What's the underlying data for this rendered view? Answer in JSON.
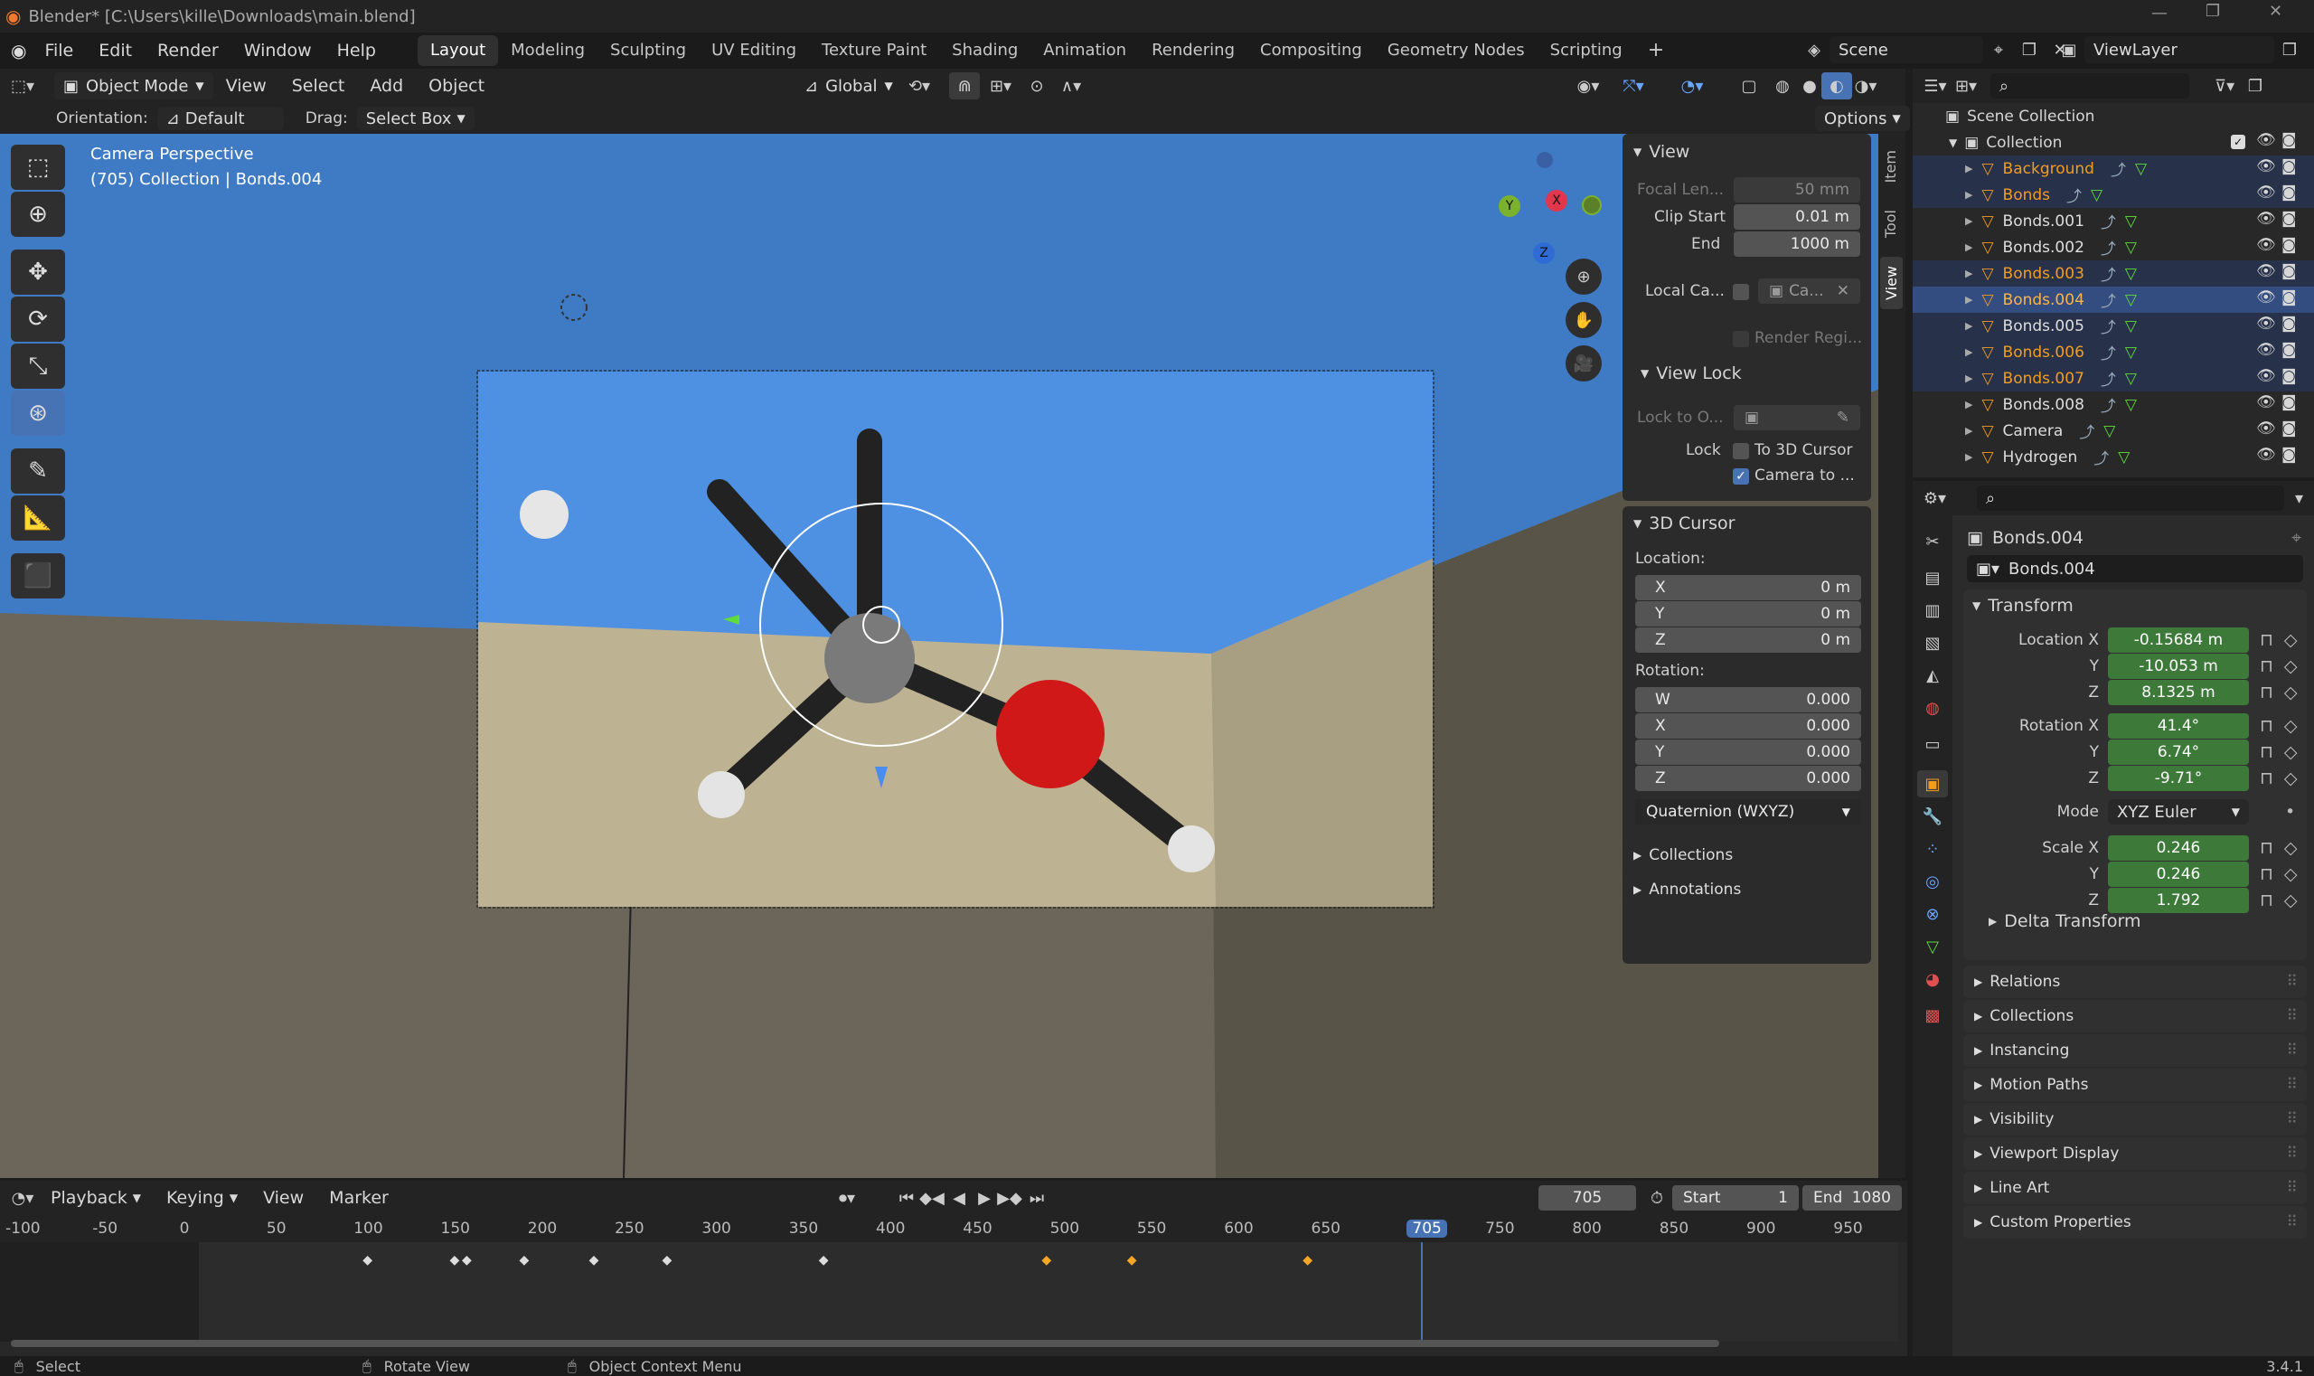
{
  "window": {
    "title": "Blender* [C:\\Users\\kille\\Downloads\\main.blend]"
  },
  "menu": [
    "File",
    "Edit",
    "Render",
    "Window",
    "Help"
  ],
  "workspaces": [
    "Layout",
    "Modeling",
    "Sculpting",
    "UV Editing",
    "Texture Paint",
    "Shading",
    "Animation",
    "Rendering",
    "Compositing",
    "Geometry Nodes",
    "Scripting"
  ],
  "scene": {
    "name": "Scene",
    "view_layer": "ViewLayer"
  },
  "viewport": {
    "mode": "Object Mode",
    "menus": [
      "View",
      "Select",
      "Add",
      "Object"
    ],
    "transform": "Global",
    "orientation_label": "Orientation:",
    "orientation": "Default",
    "drag_label": "Drag:",
    "drag": "Select Box",
    "options": "Options",
    "camera_label": "Camera Perspective",
    "info": "(705) Collection | Bonds.004"
  },
  "npanel": {
    "tabs": [
      "Item",
      "Tool",
      "View"
    ],
    "view_title": "View",
    "focal_label": "Focal Len...",
    "focal": "50 mm",
    "clip_start_label": "Clip Start",
    "clip_start": "0.01 m",
    "end_label": "End",
    "end": "1000 m",
    "local_cam_label": "Local Ca...",
    "local_cam": "Ca...",
    "render_region": "Render Regi...",
    "view_lock_title": "View Lock",
    "lock_to_label": "Lock to O...",
    "lock_label": "Lock",
    "to_3d_cursor": "To 3D Cursor",
    "camera_to": "Camera to ...",
    "cursor_title": "3D Cursor",
    "location_label": "Location:",
    "loc": [
      {
        "k": "X",
        "v": "0 m"
      },
      {
        "k": "Y",
        "v": "0 m"
      },
      {
        "k": "Z",
        "v": "0 m"
      }
    ],
    "rotation_label": "Rotation:",
    "rot": [
      {
        "k": "W",
        "v": "0.000"
      },
      {
        "k": "X",
        "v": "0.000"
      },
      {
        "k": "Y",
        "v": "0.000"
      },
      {
        "k": "Z",
        "v": "0.000"
      }
    ],
    "rot_mode": "Quaternion (WXYZ)",
    "collections": "Collections",
    "annotations": "Annotations"
  },
  "outliner": {
    "scene_collection": "Scene Collection",
    "collection": "Collection",
    "items": [
      {
        "name": "Background",
        "sel": true,
        "hl": true
      },
      {
        "name": "Bonds",
        "sel": true,
        "hl": true
      },
      {
        "name": "Bonds.001",
        "sel": false,
        "hl": false
      },
      {
        "name": "Bonds.002",
        "sel": false,
        "hl": false
      },
      {
        "name": "Bonds.003",
        "sel": true,
        "hl": true
      },
      {
        "name": "Bonds.004",
        "sel": true,
        "hl": true,
        "active": true
      },
      {
        "name": "Bonds.005",
        "sel": false,
        "hl": true
      },
      {
        "name": "Bonds.006",
        "sel": true,
        "hl": true
      },
      {
        "name": "Bonds.007",
        "sel": true,
        "hl": true
      },
      {
        "name": "Bonds.008",
        "sel": false,
        "hl": false
      },
      {
        "name": "Camera",
        "sel": false,
        "hl": false
      },
      {
        "name": "Hydrogen",
        "sel": false,
        "hl": false
      }
    ]
  },
  "properties": {
    "object_name": "Bonds.004",
    "data_name": "Bonds.004",
    "transform_title": "Transform",
    "location_label": "Location X",
    "location": [
      {
        "k": "Location X",
        "v": "-0.15684 m"
      },
      {
        "k": "Y",
        "v": "-10.053 m"
      },
      {
        "k": "Z",
        "v": "8.1325 m"
      }
    ],
    "rotation": [
      {
        "k": "Rotation X",
        "v": "41.4°"
      },
      {
        "k": "Y",
        "v": "6.74°"
      },
      {
        "k": "Z",
        "v": "-9.71°"
      }
    ],
    "mode_label": "Mode",
    "mode": "XYZ Euler",
    "scale": [
      {
        "k": "Scale X",
        "v": "0.246"
      },
      {
        "k": "Y",
        "v": "0.246"
      },
      {
        "k": "Z",
        "v": "1.792"
      }
    ],
    "delta": "Delta Transform",
    "sections": [
      "Relations",
      "Collections",
      "Instancing",
      "Motion Paths",
      "Visibility",
      "Viewport Display",
      "Line Art",
      "Custom Properties"
    ]
  },
  "timeline": {
    "menus": [
      "Playback",
      "Keying",
      "View",
      "Marker"
    ],
    "frame": "705",
    "start_label": "Start",
    "start": "1",
    "end_label": "End",
    "end": "1080",
    "ticks": [
      "-100",
      "-50",
      "0",
      "50",
      "100",
      "150",
      "200",
      "250",
      "300",
      "350",
      "400",
      "450",
      "500",
      "550",
      "600",
      "650",
      "705",
      "750",
      "800",
      "850",
      "900",
      "950"
    ]
  },
  "statusbar": {
    "select": "Select",
    "rotate": "Rotate View",
    "context": "Object Context Menu",
    "version": "3.4.1"
  },
  "colors": {
    "accent": "#4772b3",
    "selected_orange": "#f39c1f",
    "green_field": "#3d7a39",
    "sky": "#4a83c4"
  }
}
